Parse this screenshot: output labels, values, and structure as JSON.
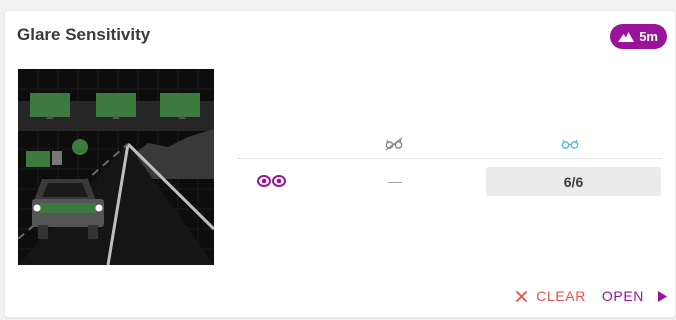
{
  "card": {
    "title": "Glare Sensitivity",
    "badge": {
      "text": "5m",
      "icon": "mountain-icon"
    }
  },
  "table": {
    "columns": [
      {
        "icon": "glasses-off-icon",
        "color": "#888888"
      },
      {
        "icon": "glasses-on-icon",
        "color": "#5fb1e6"
      }
    ],
    "rows": [
      {
        "icon": "eyes-icon",
        "without_correction": "—",
        "with_correction": "6/6"
      }
    ]
  },
  "actions": {
    "clear_label": "CLEAR",
    "open_label": "OPEN"
  },
  "colors": {
    "accent": "#9b139b",
    "clear": "#e2554f",
    "glasses_on": "#5fb1e6"
  }
}
